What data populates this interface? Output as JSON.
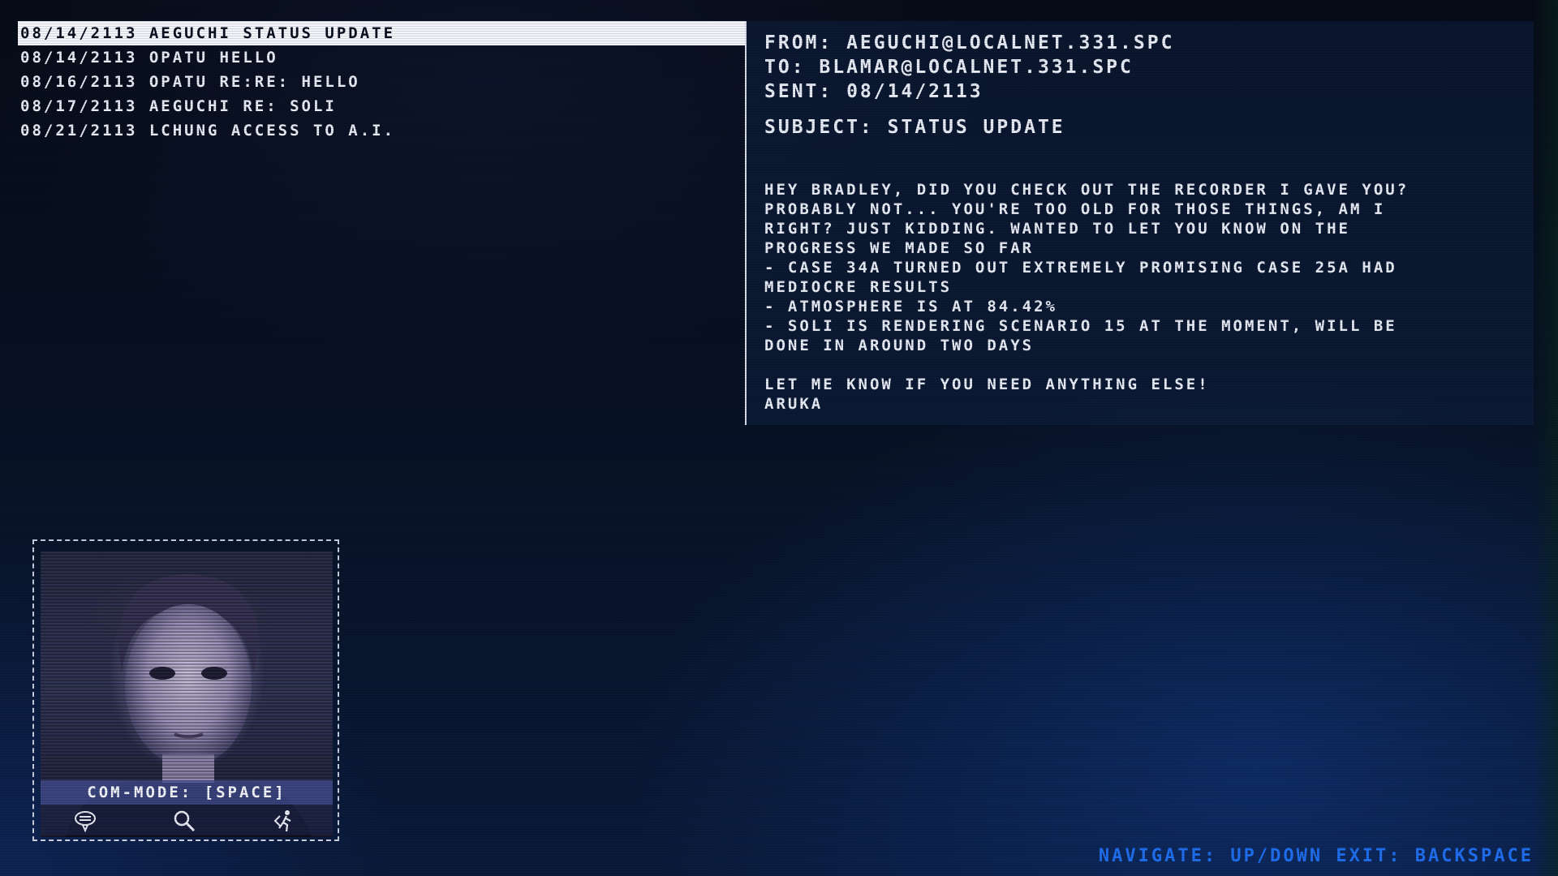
{
  "emails": [
    {
      "label": "08/14/2113 AEGUCHI STATUS UPDATE",
      "selected": true
    },
    {
      "label": "08/14/2113 OPATU HELLO",
      "selected": false
    },
    {
      "label": "08/16/2113 OPATU RE:RE: HELLO",
      "selected": false
    },
    {
      "label": "08/17/2113 AEGUCHI RE: SOLI",
      "selected": false
    },
    {
      "label": "08/21/2113 LCHUNG ACCESS TO A.I.",
      "selected": false
    }
  ],
  "reader": {
    "from": "FROM: AEGUCHI@LOCALNET.331.SPC",
    "to": "TO: BLAMAR@LOCALNET.331.SPC",
    "sent": "SENT: 08/14/2113",
    "subject": "SUBJECT: STATUS UPDATE",
    "body_lines": [
      "HEY BRADLEY, DID YOU CHECK OUT THE RECORDER I GAVE YOU?",
      "PROBABLY NOT... YOU'RE TOO OLD FOR THOSE THINGS, AM I",
      "RIGHT? JUST KIDDING. WANTED TO LET YOU KNOW ON THE",
      "PROGRESS WE MADE SO FAR",
      "- CASE 34A TURNED OUT EXTREMELY PROMISING CASE 25A HAD",
      "MEDIOCRE RESULTS",
      "- ATMOSPHERE IS AT 84.42%",
      "- SOLI IS RENDERING SCENARIO 15 AT THE MOMENT, WILL BE",
      "DONE IN AROUND TWO DAYS",
      "",
      "LET ME KNOW IF YOU NEED ANYTHING  ELSE!",
      "ARUKA"
    ]
  },
  "portrait": {
    "comm_mode": "COM-MODE: [SPACE]",
    "icons": [
      "chat-bubble-icon",
      "search-icon",
      "walk-icon"
    ]
  },
  "footer": {
    "hint": "NAVIGATE: UP/DOWN EXIT: BACKSPACE"
  },
  "colors": {
    "accent_blue": "#1f6ff0",
    "text": "#e8ecf6",
    "selection_bg": "#f3f5fb"
  }
}
